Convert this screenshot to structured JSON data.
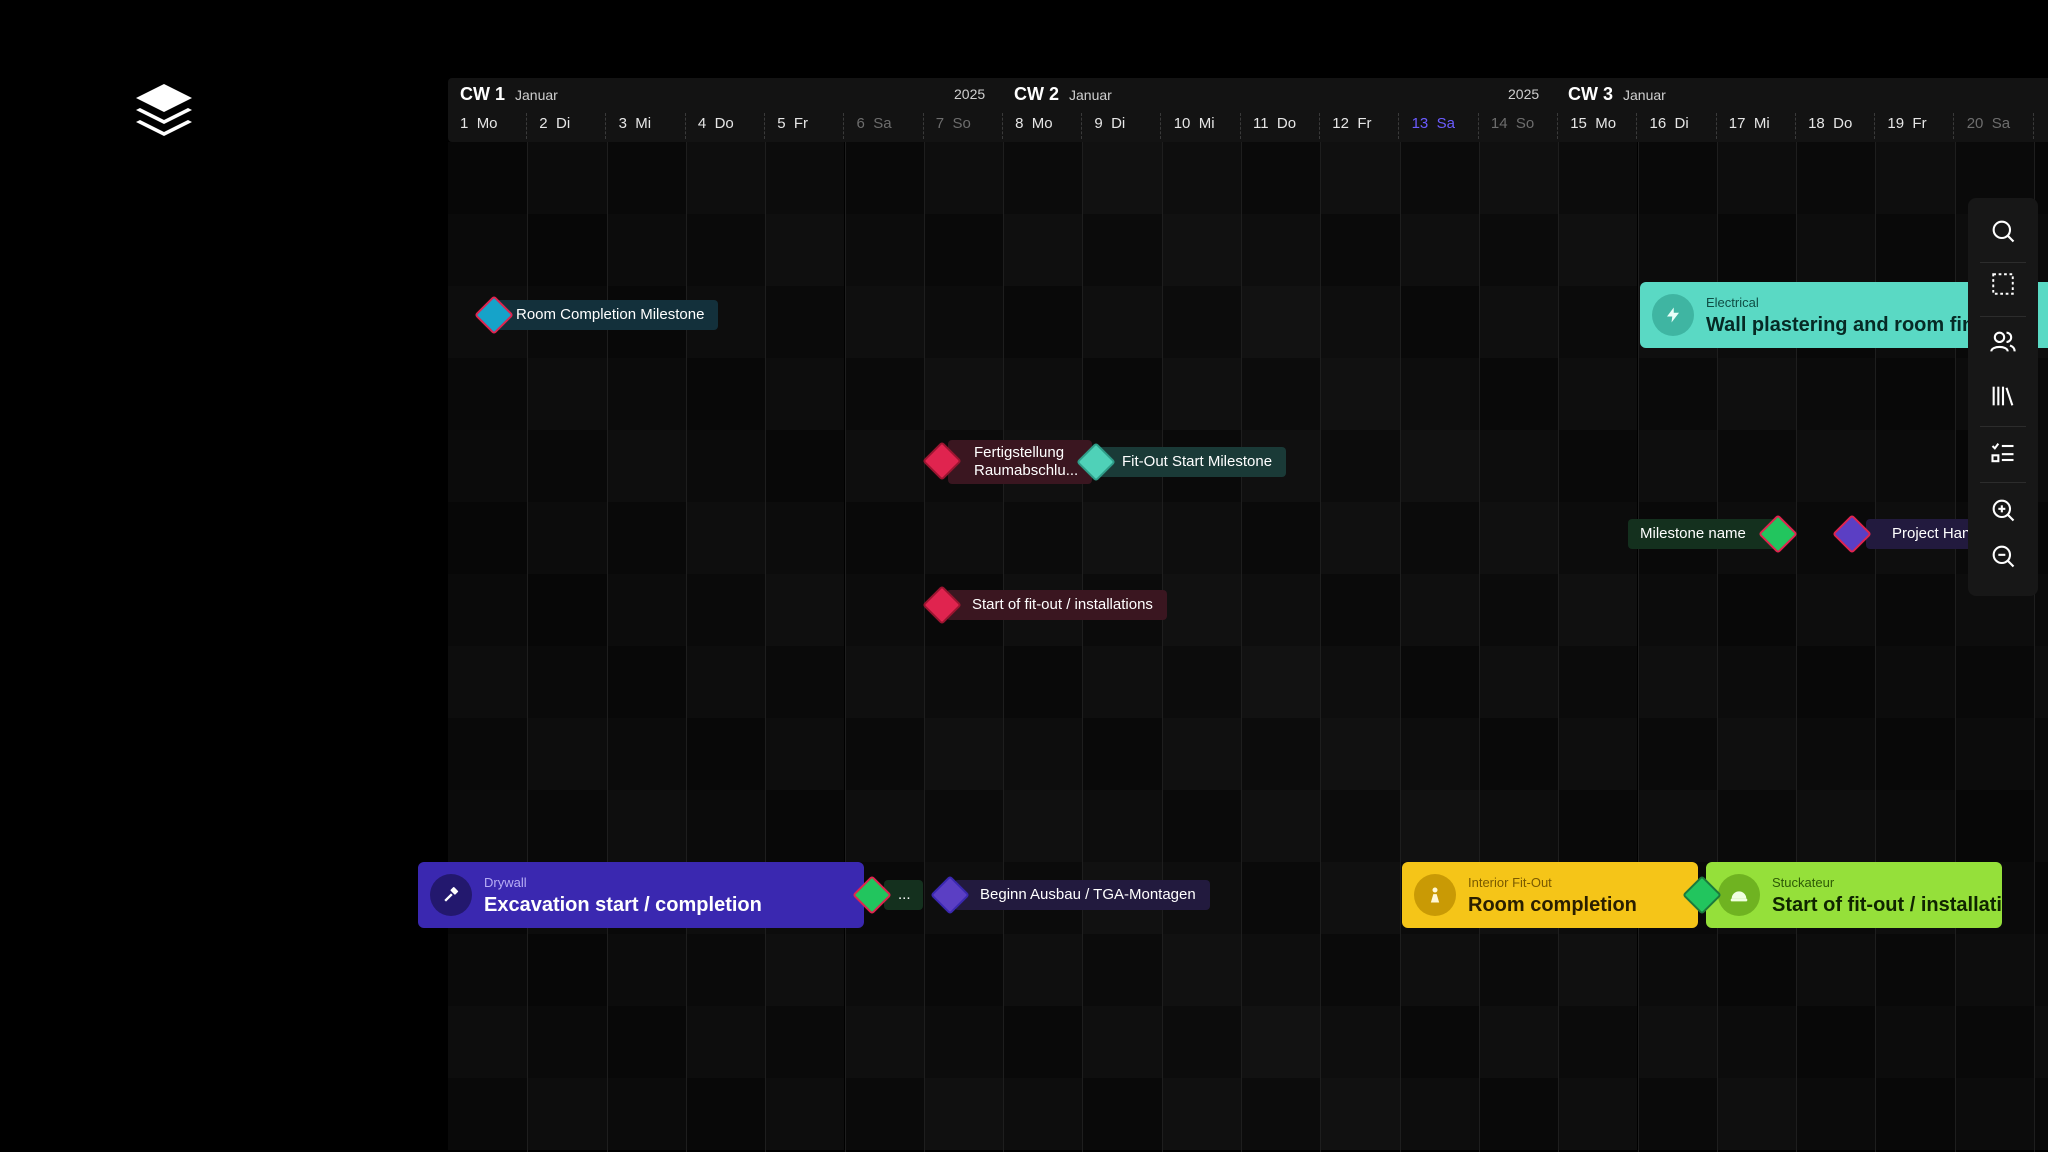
{
  "header": {
    "weeks": [
      {
        "label": "CW 1",
        "month": "Januar",
        "year": "2025"
      },
      {
        "label": "CW 2",
        "month": "Januar",
        "year": "2025"
      },
      {
        "label": "CW 3",
        "month": "Januar"
      }
    ],
    "days": [
      {
        "num": "1",
        "name": "Mo"
      },
      {
        "num": "2",
        "name": "Di"
      },
      {
        "num": "3",
        "name": "Mi"
      },
      {
        "num": "4",
        "name": "Do"
      },
      {
        "num": "5",
        "name": "Fr"
      },
      {
        "num": "6",
        "name": "Sa"
      },
      {
        "num": "7",
        "name": "So"
      },
      {
        "num": "8",
        "name": "Mo"
      },
      {
        "num": "9",
        "name": "Di"
      },
      {
        "num": "10",
        "name": "Mi"
      },
      {
        "num": "11",
        "name": "Do"
      },
      {
        "num": "12",
        "name": "Fr"
      },
      {
        "num": "13",
        "name": "Sa"
      },
      {
        "num": "14",
        "name": "So"
      },
      {
        "num": "15",
        "name": "Mo"
      },
      {
        "num": "16",
        "name": "Di"
      },
      {
        "num": "17",
        "name": "Mi"
      },
      {
        "num": "18",
        "name": "Do"
      },
      {
        "num": "19",
        "name": "Fr"
      },
      {
        "num": "20",
        "name": "Sa"
      }
    ]
  },
  "milestones": {
    "room_completion": "Room Completion Milestone",
    "fertigstellung_line1": "Fertigstellung",
    "fertigstellung_line2": "Raumabschlu...",
    "fitout_start": "Fit-Out Start Milestone",
    "milestone_name": "Milestone name",
    "project_handover": "Project Hand",
    "start_fitout": "Start of fit-out / installations",
    "ellipsis": "...",
    "beginn_ausbau": "Beginn Ausbau / TGA-Montagen"
  },
  "tasks": {
    "electrical": {
      "category": "Electrical",
      "title": "Wall plastering and room finishing"
    },
    "drywall": {
      "category": "Drywall",
      "title": "Excavation start / completion"
    },
    "interior": {
      "category": "Interior Fit-Out",
      "title": "Room completion"
    },
    "stuckateur": {
      "category": "Stuckateur",
      "title": "Start of fit-out / installations"
    }
  },
  "colors": {
    "cyan": "#16a3c9",
    "red": "#e0244f",
    "teal": "#4fd1b8",
    "green": "#22c55e",
    "purple": "#5b3fc4",
    "task_electrical": "#5ad9c4",
    "task_drywall": "#3a28b0",
    "task_interior": "#f5c518",
    "task_stuckateur": "#95e03a",
    "today": "#6b5cff"
  },
  "toolbar": {
    "icons": [
      "search-icon",
      "selection-icon",
      "users-icon",
      "library-icon",
      "checklist-icon",
      "zoom-in-icon",
      "zoom-out-icon"
    ]
  }
}
